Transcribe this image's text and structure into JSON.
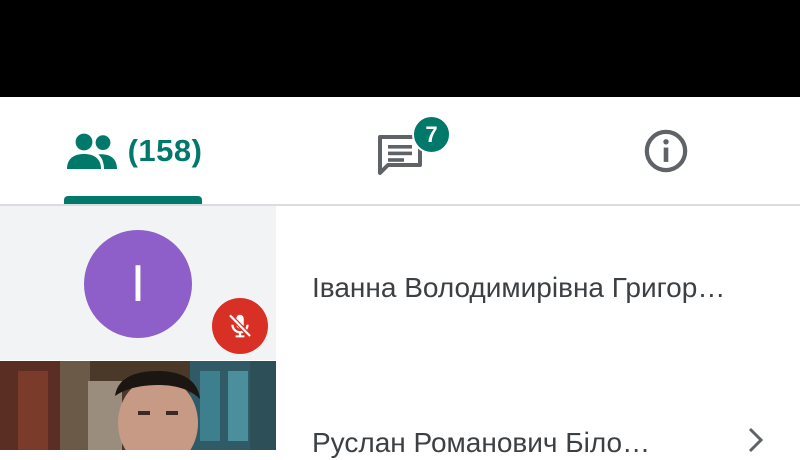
{
  "tabs": {
    "people_count": "(158)",
    "chat_badge": "7"
  },
  "participants": [
    {
      "initial": "І",
      "name": "Іванна Володимирівна Григор…",
      "avatar_color": "#8e5fc8",
      "muted": true
    },
    {
      "name": "Руслан Романович Біло…",
      "video": true
    }
  ],
  "colors": {
    "accent": "#00796b",
    "muted_red": "#d93025",
    "topbar": "#000000"
  },
  "icons": [
    "people-icon",
    "chat-icon",
    "info-icon",
    "mic-off-icon",
    "chevron-right-icon"
  ]
}
